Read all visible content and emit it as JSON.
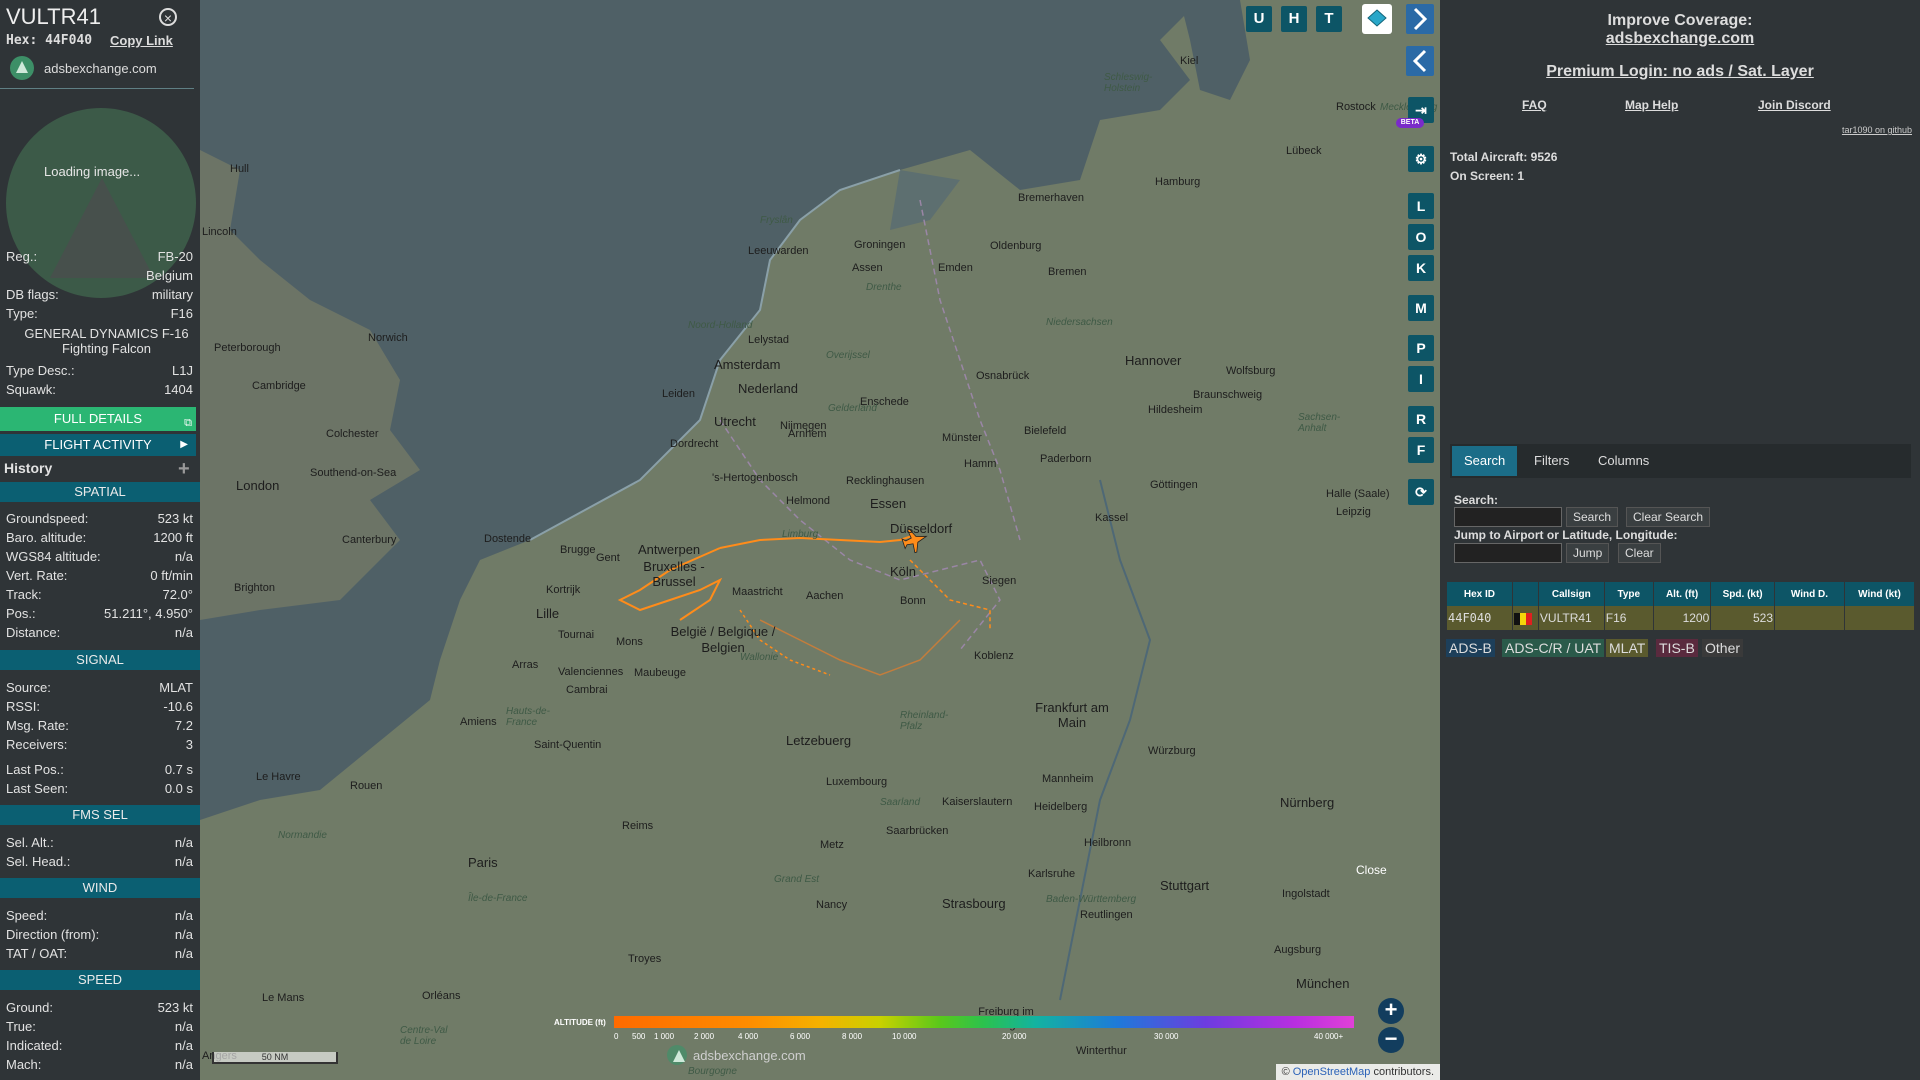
{
  "aircraft": {
    "callsign": "VULTR41",
    "hex_label": "Hex: 44F040",
    "copy_link": "Copy Link",
    "brand": "adsbexchange.com",
    "loading_image": "Loading image...",
    "info": [
      {
        "label": "Reg.:",
        "value": "FB-20"
      },
      {
        "label": "",
        "value": "Belgium"
      },
      {
        "label": "DB flags:",
        "value": "military"
      },
      {
        "label": "Type:",
        "value": "F16"
      },
      {
        "label": "",
        "value": "GENERAL DYNAMICS F-16 Fighting Falcon"
      },
      {
        "label": "Type Desc.:",
        "value": "L1J"
      },
      {
        "label": "Squawk:",
        "value": "1404"
      }
    ],
    "full_details": "FULL DETAILS",
    "flight_activity": "FLIGHT ACTIVITY",
    "history": "History",
    "sections": {
      "spatial": "SPATIAL",
      "signal": "SIGNAL",
      "fms": "FMS SEL",
      "wind": "WIND",
      "speed": "SPEED"
    },
    "spatial": [
      {
        "label": "Groundspeed:",
        "value": "523 kt"
      },
      {
        "label": "Baro. altitude:",
        "value": "1200 ft"
      },
      {
        "label": "WGS84 altitude:",
        "value": "n/a"
      },
      {
        "label": "Vert. Rate:",
        "value": "0 ft/min"
      },
      {
        "label": "Track:",
        "value": "72.0°"
      },
      {
        "label": "Pos.:",
        "value": "51.211°, 4.950°"
      },
      {
        "label": "Distance:",
        "value": "n/a"
      }
    ],
    "signal": [
      {
        "label": "Source:",
        "value": "MLAT"
      },
      {
        "label": "RSSI:",
        "value": "-10.6"
      },
      {
        "label": "Msg. Rate:",
        "value": "7.2"
      },
      {
        "label": "Receivers:",
        "value": "3"
      },
      {
        "label": "Last Pos.:",
        "value": "0.7 s"
      },
      {
        "label": "Last Seen:",
        "value": "0.0 s"
      }
    ],
    "fms": [
      {
        "label": "Sel. Alt.:",
        "value": "n/a"
      },
      {
        "label": "Sel. Head.:",
        "value": "n/a"
      }
    ],
    "wind": [
      {
        "label": "Speed:",
        "value": "n/a"
      },
      {
        "label": "Direction (from):",
        "value": "n/a"
      },
      {
        "label": "TAT / OAT:",
        "value": "n/a"
      }
    ],
    "speed": [
      {
        "label": "Ground:",
        "value": "523 kt"
      },
      {
        "label": "True:",
        "value": "n/a"
      },
      {
        "label": "Indicated:",
        "value": "n/a"
      },
      {
        "label": "Mach:",
        "value": "n/a"
      }
    ]
  },
  "map": {
    "top_buttons": [
      "U",
      "H",
      "T"
    ],
    "side_buttons": [
      "L",
      "O",
      "K",
      "M",
      "P",
      "I",
      "R",
      "F"
    ],
    "beta": "BETA",
    "close": "Close",
    "altitude_label": "ALTITUDE (ft)",
    "altitude_ticks": [
      "0",
      "500",
      "1 000",
      "2 000",
      "4 000",
      "6 000",
      "8 000",
      "10 000",
      "20 000",
      "30 000",
      "40 000+"
    ],
    "brand": "adsbexchange.com",
    "scale": "50 NM",
    "attribution_prefix": "©",
    "attribution_link": "OpenStreetMap",
    "attribution_suffix": "contributors.",
    "cities": [
      {
        "name": "Kiel"
      },
      {
        "name": "Rostock"
      },
      {
        "name": "Lübeck"
      },
      {
        "name": "Hamburg"
      },
      {
        "name": "Bremerhaven"
      },
      {
        "name": "Oldenburg"
      },
      {
        "name": "Bremen"
      },
      {
        "name": "Groningen"
      },
      {
        "name": "Assen"
      },
      {
        "name": "Leeuwarden"
      },
      {
        "name": "Emden"
      },
      {
        "name": "Hull"
      },
      {
        "name": "Lincoln"
      },
      {
        "name": "Norwich"
      },
      {
        "name": "Peterborough"
      },
      {
        "name": "Cambridge"
      },
      {
        "name": "Colchester"
      },
      {
        "name": "Southend-on-Sea"
      },
      {
        "name": "London"
      },
      {
        "name": "Canterbury"
      },
      {
        "name": "Brighton"
      },
      {
        "name": "Amsterdam"
      },
      {
        "name": "Lelystad"
      },
      {
        "name": "Leiden"
      },
      {
        "name": "Utrecht"
      },
      {
        "name": "Nederland"
      },
      {
        "name": "Dordrecht"
      },
      {
        "name": "Nijmegen"
      },
      {
        "name": "Arnhem"
      },
      {
        "name": "Enschede"
      },
      {
        "name": "Osnabrück"
      },
      {
        "name": "Hannover"
      },
      {
        "name": "Wolfsburg"
      },
      {
        "name": "Braunschweig"
      },
      {
        "name": "Hildesheim"
      },
      {
        "name": "Münster"
      },
      {
        "name": "Bielefeld"
      },
      {
        "name": "Paderborn"
      },
      {
        "name": "Hamm"
      },
      {
        "name": "Recklinghausen"
      },
      {
        "name": "Essen"
      },
      {
        "name": "Düsseldorf"
      },
      {
        "name": "Göttingen"
      },
      {
        "name": "Halle (Saale)"
      },
      {
        "name": "Leipzig"
      },
      {
        "name": "Kassel"
      },
      {
        "name": "Siegen"
      },
      {
        "name": "Köln"
      },
      {
        "name": "Bonn"
      },
      {
        "name": "Koblenz"
      },
      {
        "name": "Helmond"
      },
      {
        "name": "'s-Hertogenbosch"
      },
      {
        "name": "Dostende"
      },
      {
        "name": "Brugge"
      },
      {
        "name": "Gent"
      },
      {
        "name": "Antwerpen"
      },
      {
        "name": "Bruxelles - Brussel"
      },
      {
        "name": "Maastricht"
      },
      {
        "name": "Aachen"
      },
      {
        "name": "Kortrijk"
      },
      {
        "name": "Lille"
      },
      {
        "name": "Tournai"
      },
      {
        "name": "Mons"
      },
      {
        "name": "België / Belgique / Belgien"
      },
      {
        "name": "Arras"
      },
      {
        "name": "Valenciennes"
      },
      {
        "name": "Maubeuge"
      },
      {
        "name": "Cambrai"
      },
      {
        "name": "Amiens"
      },
      {
        "name": "Saint-Quentin"
      },
      {
        "name": "Le Havre"
      },
      {
        "name": "Rouen"
      },
      {
        "name": "Paris"
      },
      {
        "name": "Reims"
      },
      {
        "name": "Letzebuerg"
      },
      {
        "name": "Luxembourg"
      },
      {
        "name": "Frankfurt am Main"
      },
      {
        "name": "Würzburg"
      },
      {
        "name": "Nürnberg"
      },
      {
        "name": "Mannheim"
      },
      {
        "name": "Heidelberg"
      },
      {
        "name": "Kaiserslautern"
      },
      {
        "name": "Saarbrücken"
      },
      {
        "name": "Metz"
      },
      {
        "name": "Nancy"
      },
      {
        "name": "Karlsruhe"
      },
      {
        "name": "Heilbronn"
      },
      {
        "name": "Stuttgart"
      },
      {
        "name": "Strasbourg"
      },
      {
        "name": "Reutlingen"
      },
      {
        "name": "Ingolstadt"
      },
      {
        "name": "Augsburg"
      },
      {
        "name": "München"
      },
      {
        "name": "Freiburg im Breisgau"
      },
      {
        "name": "Winterthur"
      },
      {
        "name": "Orléans"
      },
      {
        "name": "Le Mans"
      },
      {
        "name": "Angers"
      },
      {
        "name": "Troyes"
      }
    ],
    "regions": [
      {
        "name": "Schleswig-Holstein"
      },
      {
        "name": "Mecklenburg"
      },
      {
        "name": "Niedersachsen"
      },
      {
        "name": "Sachsen-Anhalt"
      },
      {
        "name": "Fryslân"
      },
      {
        "name": "Drenthe"
      },
      {
        "name": "Overijssel"
      },
      {
        "name": "Gelderland"
      },
      {
        "name": "Noord-Holland"
      },
      {
        "name": "Limburg"
      },
      {
        "name": "Wallonie"
      },
      {
        "name": "Rheinland-Pfalz"
      },
      {
        "name": "Hauts-de-France"
      },
      {
        "name": "Normandie"
      },
      {
        "name": "Île-de-France"
      },
      {
        "name": "Grand Est"
      },
      {
        "name": "Baden-Württemberg"
      },
      {
        "name": "Saarland"
      },
      {
        "name": "Centre-Val de Loire"
      },
      {
        "name": "Bourgogne"
      }
    ]
  },
  "right": {
    "improve_title": "Improve Coverage:",
    "improve_link": "adsbexchange.com",
    "premium": "Premium Login: no ads / Sat. Layer",
    "faq": "FAQ",
    "map_help": "Map Help",
    "join_discord": "Join Discord",
    "tar": "tar1090 on github",
    "total_aircraft": "Total Aircraft: 9526",
    "on_screen": "On Screen: 1",
    "tabs": [
      "Search",
      "Filters",
      "Columns"
    ],
    "search_label": "Search:",
    "search_btn": "Search",
    "clear_search_btn": "Clear Search",
    "jump_label": "Jump to Airport or Latitude, Longitude:",
    "jump_btn": "Jump",
    "clear_btn": "Clear",
    "table_headers": [
      "Hex ID",
      "",
      "Callsign",
      "Type",
      "Alt. (ft)",
      "Spd. (kt)",
      "Wind D.",
      "Wind (kt)"
    ],
    "table_row": {
      "hex": "44F040",
      "callsign": "VULTR41",
      "type": "F16",
      "alt": "1200",
      "spd": "523"
    },
    "legend": [
      {
        "label": "ADS-B",
        "color": "#1d3f5a"
      },
      {
        "label": "ADS-C/R / UAT",
        "color": "#2a5a4a"
      },
      {
        "label": "MLAT",
        "color": "#5a5a2e"
      },
      {
        "label": "TIS-B",
        "color": "#5a2a3e"
      },
      {
        "label": "Other",
        "color": "#3a3a3a"
      }
    ]
  }
}
